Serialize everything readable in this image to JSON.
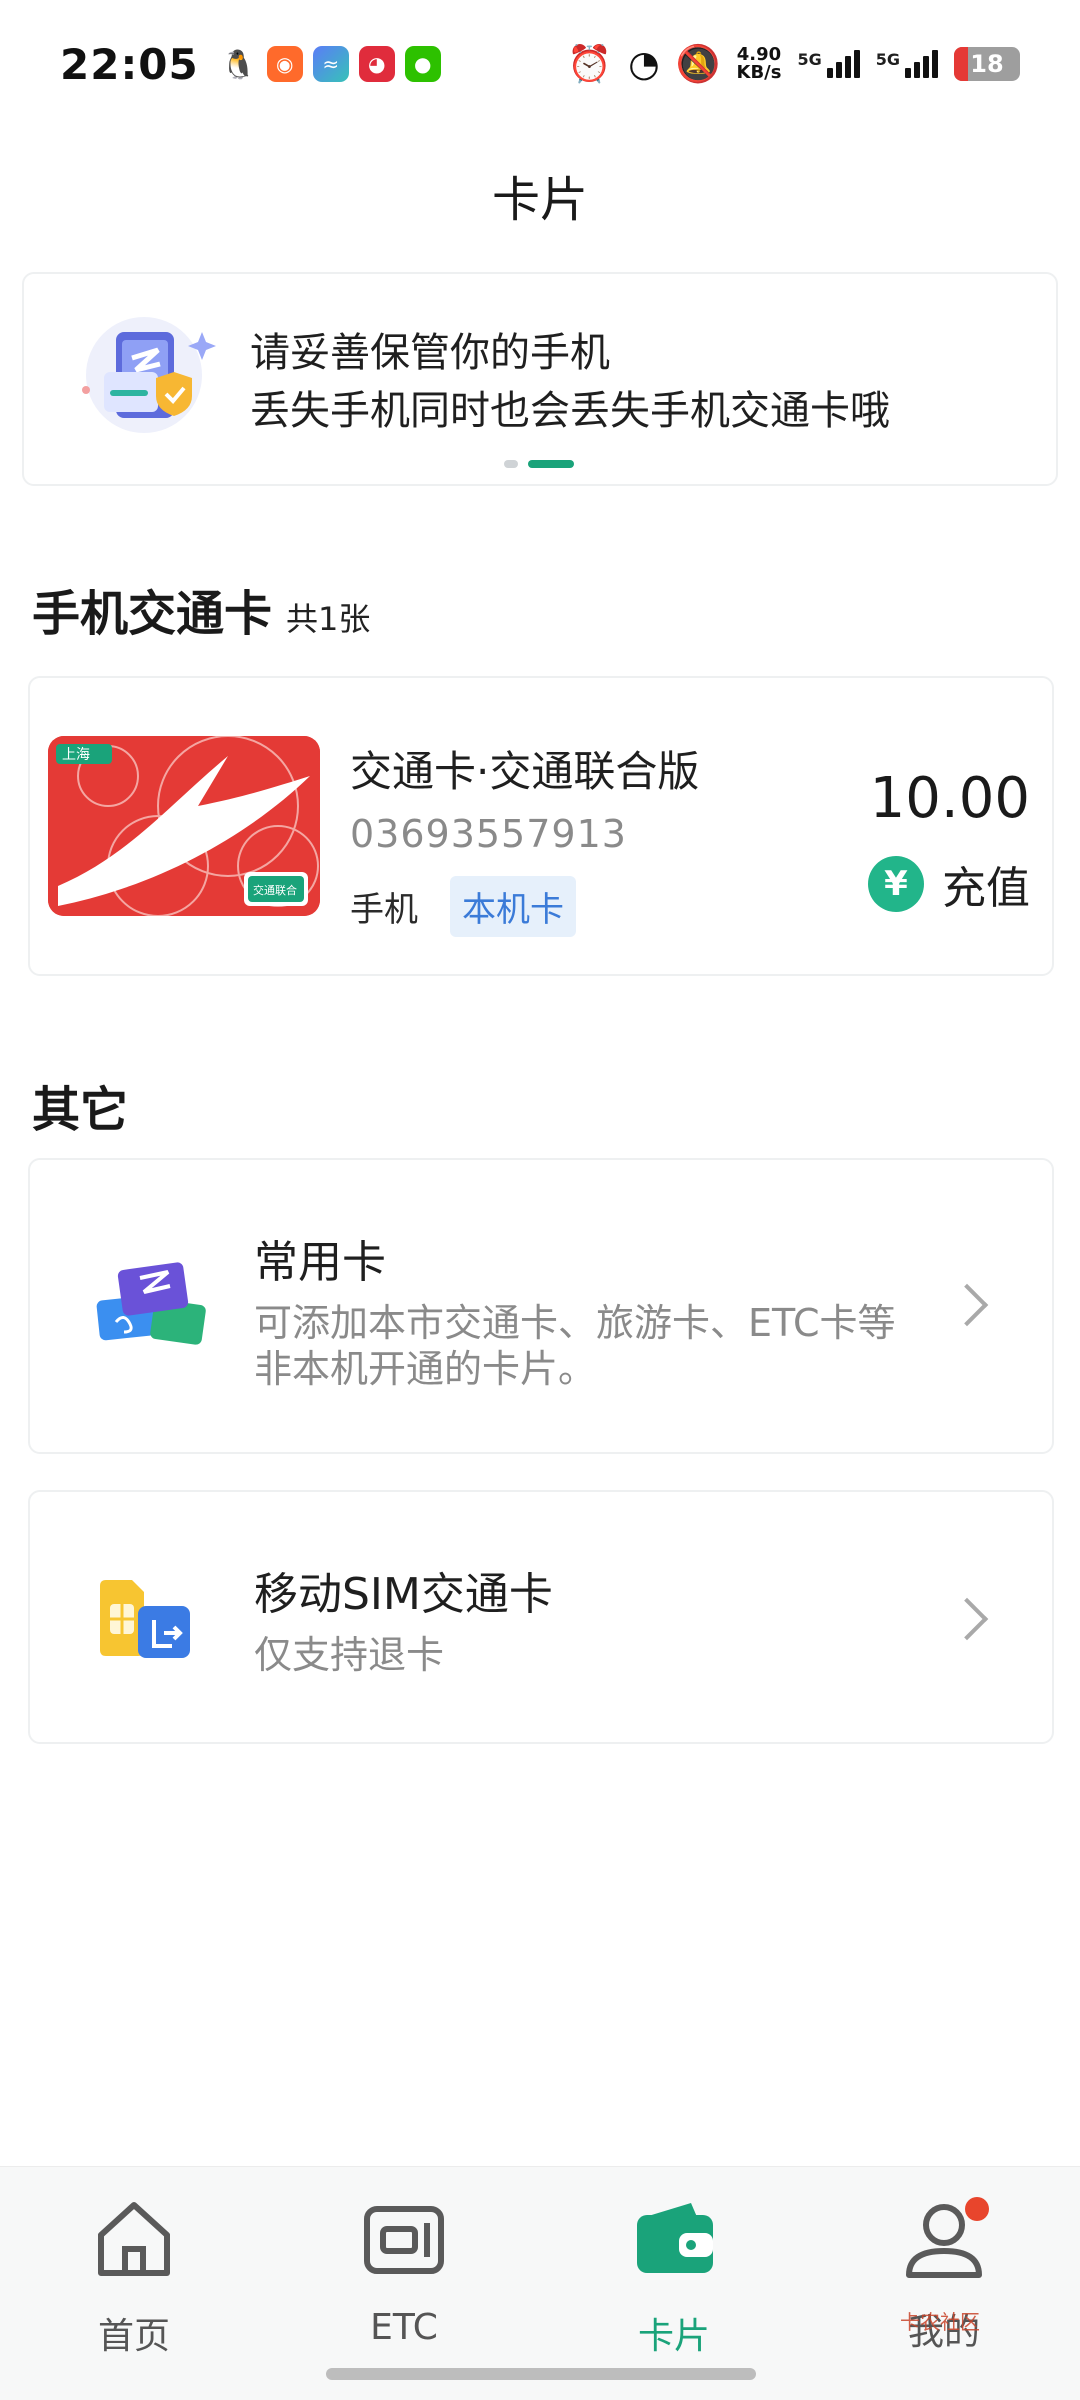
{
  "status_bar": {
    "time": "22:05",
    "net_speed_value": "4.90",
    "net_speed_unit": "KB/s",
    "network_1": "5G",
    "network_2": "5G",
    "battery": "18",
    "app_icons": [
      "qq-icon",
      "app2-icon",
      "app3-icon",
      "tmall-icon",
      "wechat-icon"
    ],
    "system_icons": [
      "alarm-icon",
      "speed-icon",
      "mute-icon"
    ]
  },
  "header": {
    "title": "卡片"
  },
  "banner": {
    "line1": "请妥善保管你的手机",
    "line2": "丢失手机同时也会丢失手机交通卡哦",
    "page_count": 2,
    "active_page": 2
  },
  "transit_section": {
    "title": "手机交通卡",
    "count": "共1张",
    "card": {
      "name": "交通卡·交通联合版",
      "number": "03693557913",
      "device": "手机",
      "tag": "本机卡",
      "balance": "10.00",
      "recharge_icon": "¥",
      "recharge_label": "充值",
      "image_brand": "上海",
      "image_badge": "交通联合"
    }
  },
  "other_section": {
    "title": "其它",
    "items": [
      {
        "title": "常用卡",
        "desc_line1": "可添加本市交通卡、旅游卡、ETC卡等",
        "desc_line2": "非本机开通的卡片。"
      },
      {
        "title": "移动SIM交通卡",
        "desc_line1": "仅支持退卡",
        "desc_line2": ""
      }
    ]
  },
  "bottom_nav": {
    "items": [
      {
        "label": "首页",
        "icon": "home-icon"
      },
      {
        "label": "ETC",
        "icon": "etc-icon"
      },
      {
        "label": "卡片",
        "icon": "wallet-icon",
        "active": true
      },
      {
        "label": "我的",
        "icon": "profile-icon",
        "badge": true
      }
    ]
  },
  "watermark": "卡农社区",
  "colors": {
    "accent": "#1aa37a",
    "tag_bg": "#e6f0fb",
    "tag_text": "#3b7bd8",
    "card_red": "#e53935",
    "badge": "#e8452c"
  }
}
